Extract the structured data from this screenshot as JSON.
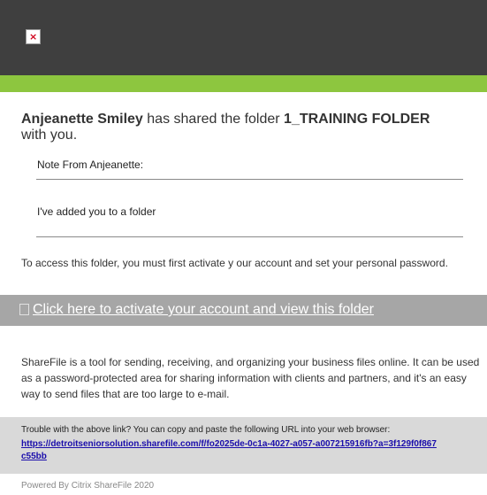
{
  "header": {
    "broken_image_icon": "broken-image-icon",
    "broken_image_glyph": "×",
    "background": "#3f3f3f",
    "accent_bar": "#8dc63f"
  },
  "share": {
    "sender_name": "Anjeanette Smiley",
    "action_text": " has shared the folder ",
    "folder_name": "1_TRAINING FOLDER",
    "suffix": " with you."
  },
  "note": {
    "label": "Note From Anjeanette:",
    "message": "I've added you to a folder"
  },
  "access_text": "To access this folder, you must first activate y our account and set your personal password.",
  "activate": {
    "link_label": "Click here to activate your account and view this folder",
    "bar_color": "#a6a6a6"
  },
  "description": "ShareFile is a tool for sending, receiving, and organizing your business files online. It can be used as a password-protected area for sharing information with clients and partners, and it's an easy way to send files that are too large to e-mail.",
  "trouble": {
    "text": "Trouble with the above link? You can copy and paste the following URL into your web browser:",
    "url": "https://detroitseniorsolution.sharefile.com/f/fo2025de-0c1a-4027-a057-a007215916fb?a=3f129f0f867c55bb"
  },
  "footer": {
    "text": "Powered By Citrix ShareFile 2020"
  }
}
